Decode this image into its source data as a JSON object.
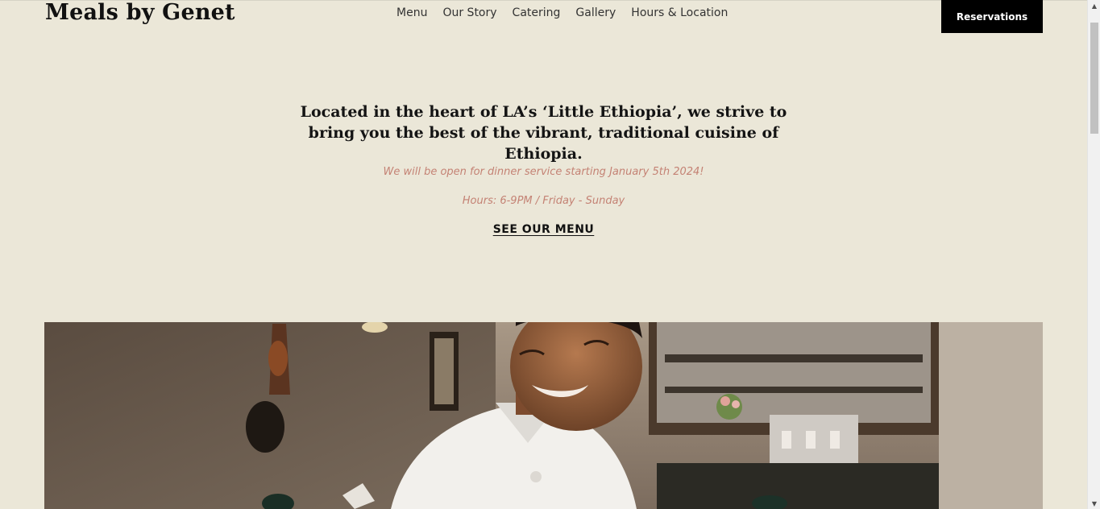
{
  "header": {
    "site_title": "Meals by Genet",
    "nav": [
      "Menu",
      "Our Story",
      "Catering",
      "Gallery",
      "Hours & Location"
    ],
    "reservations_label": "Reservations"
  },
  "intro": {
    "headline": "Located in the heart of LA’s ‘Little Ethiopia’, we strive to bring you the best of the vibrant, traditional cuisine of Ethiopia.",
    "notice": "We will be open for dinner service starting January 5th 2024!",
    "hours": "Hours: 6-9PM / Friday - Sunday",
    "menu_link": "SEE OUR MENU"
  },
  "colors": {
    "background": "#ebe7d8",
    "accent_text": "#c48274",
    "button_bg": "#000000"
  },
  "scroll": {
    "position_fraction": 0.0
  }
}
